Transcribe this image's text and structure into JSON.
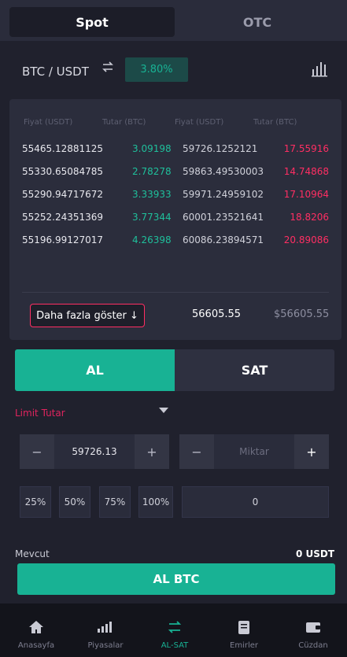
{
  "tabs": {
    "spot": "Spot",
    "otc": "OTC"
  },
  "pair": {
    "symbol": "BTC / USDT",
    "change": "3.80%"
  },
  "orderbook": {
    "headers": [
      "Fiyat (USDT)",
      "Tutar (BTC)",
      "Fiyat (USDT)",
      "Tutar (BTC)"
    ],
    "rows": [
      [
        "55465.12881125",
        "3.09198",
        "59726.1252121",
        "17.55916"
      ],
      [
        "55330.65084785",
        "2.78278",
        "59863.49530003",
        "14.74868"
      ],
      [
        "55290.94717672",
        "3.33933",
        "59971.24959102",
        "17.10964"
      ],
      [
        "55252.24351369",
        "3.77344",
        "60001.23521641",
        "18.8206"
      ],
      [
        "55196.99127017",
        "4.26398",
        "60086.23894571",
        "20.89086"
      ]
    ],
    "more_label": "Daha fazla göster ↓",
    "last_price": "56605.55",
    "last_price_usd": "$56605.55"
  },
  "trade": {
    "buy": "AL",
    "sell": "SAT",
    "order_type": "Limit Tutar",
    "price_value": "59726.13",
    "amount_placeholder": "Miktar",
    "minus": "−",
    "plus": "+",
    "percents": [
      "25%",
      "50%",
      "75%",
      "100%"
    ],
    "amount_value": "0",
    "available_label": "Mevcut",
    "available_value": "0 USDT",
    "submit": "AL BTC"
  },
  "nav": [
    {
      "label": "Anasayfa",
      "icon": "home-icon"
    },
    {
      "label": "Piyasalar",
      "icon": "bar-chart-icon"
    },
    {
      "label": "AL-SAT",
      "icon": "swap-icon"
    },
    {
      "label": "Emirler",
      "icon": "document-icon"
    },
    {
      "label": "Cüzdan",
      "icon": "wallet-icon"
    }
  ],
  "colors": {
    "accent": "#18b294",
    "sell": "#ff2e63",
    "background": "#20212d"
  }
}
